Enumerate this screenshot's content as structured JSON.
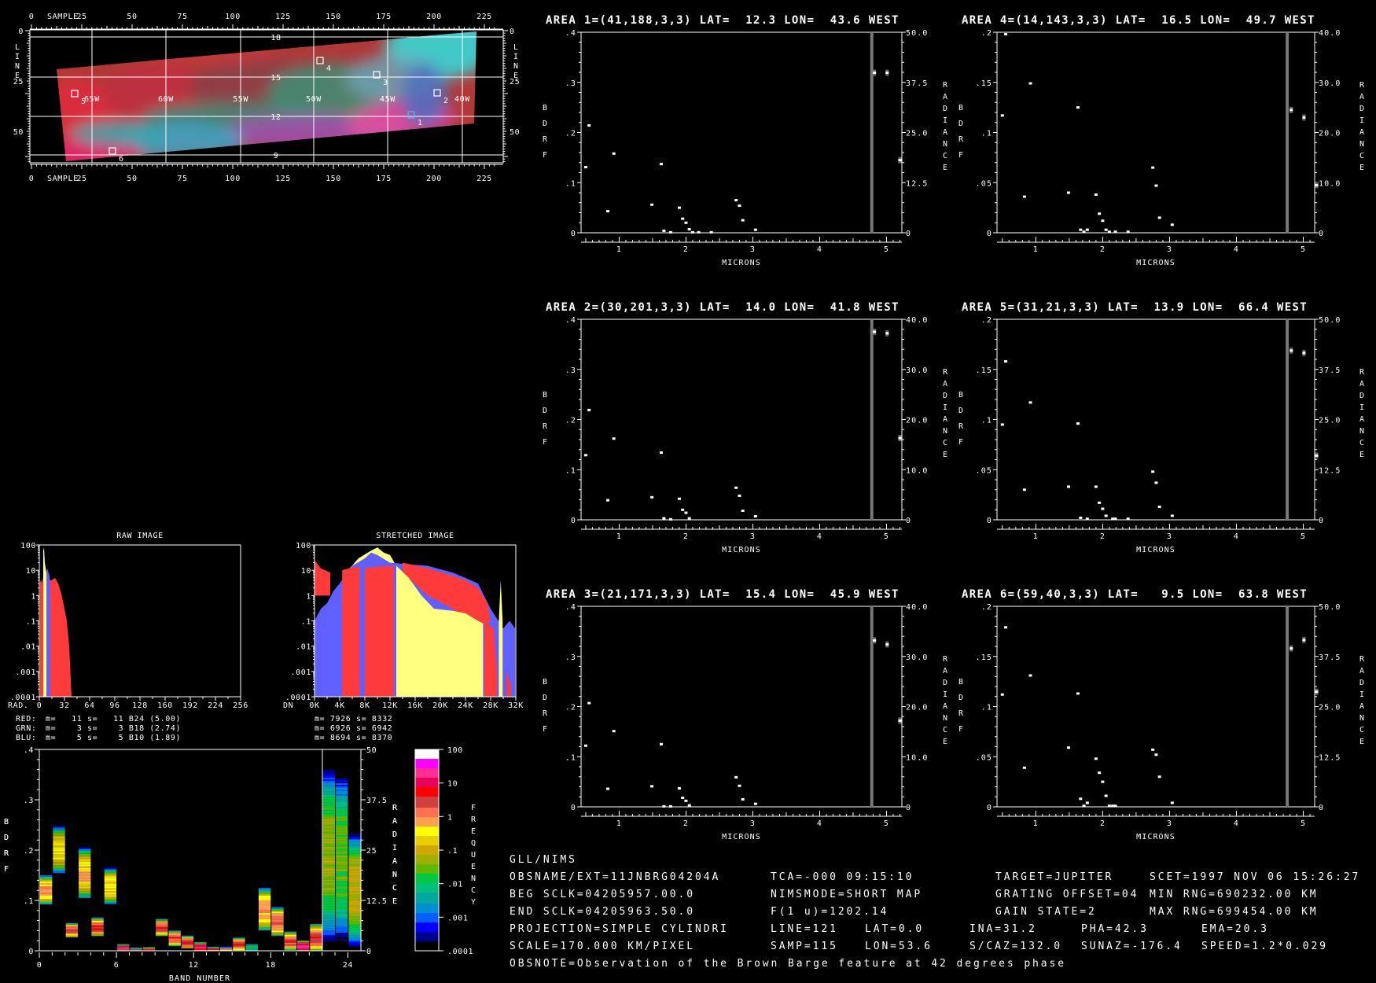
{
  "map": {
    "sample_label": "SAMPLE",
    "line_label": "LINE",
    "sample_ticks": [
      "0",
      "25",
      "50",
      "75",
      "100",
      "125",
      "150",
      "175",
      "200",
      "225"
    ],
    "line_ticks": [
      "0",
      "25",
      "50"
    ],
    "lat_labels": [
      "18",
      "15",
      "12",
      "9"
    ],
    "lon_labels": [
      "65W",
      "60W",
      "55W",
      "50W",
      "45W",
      "40W"
    ],
    "area_markers": [
      {
        "id": "1",
        "color": "#40c8f0"
      },
      {
        "id": "2",
        "color": "#ffffff"
      },
      {
        "id": "3",
        "color": "#ffffff"
      },
      {
        "id": "4",
        "color": "#ffffff"
      },
      {
        "id": "5",
        "color": "#ffffff"
      },
      {
        "id": "6",
        "color": "#ffffff"
      }
    ]
  },
  "histograms": {
    "raw": {
      "title": "RAW IMAGE",
      "x_label": "RAD.",
      "x_ticks": [
        "0",
        "32",
        "64",
        "96",
        "128",
        "160",
        "192",
        "224",
        "256"
      ],
      "y_ticks": [
        "100",
        "10",
        "1",
        ".1",
        ".01",
        ".001",
        ".0001"
      ],
      "legend": [
        {
          "channel": "RED:",
          "color": "#ff3030",
          "text": "m=   11 s=   11 B24 (5.00)"
        },
        {
          "channel": "GRN:",
          "color": "#ffff80",
          "text": "m=    3 s=    3 B18 (2.74)"
        },
        {
          "channel": "BLU:",
          "color": "#6060ff",
          "text": "m=    5 s=    5 B10 (1.89)"
        }
      ]
    },
    "stretched": {
      "title": "STRETCHED IMAGE",
      "x_label": "DN",
      "x_ticks": [
        "0K",
        "4K",
        "8K",
        "12K",
        "16K",
        "20K",
        "24K",
        "28K",
        "32K"
      ],
      "y_ticks": [
        "100",
        "10",
        "1",
        ".1",
        ".01",
        ".001",
        ".0001"
      ],
      "legend": [
        "m= 7926 s= 8332",
        "m= 6926 s= 6942",
        "m= 8694 s= 8370"
      ]
    },
    "colors": {
      "red": "#ff3a3a",
      "green": "#ffff80",
      "blue": "#6060ff"
    }
  },
  "band_plot": {
    "left_label": "BDRF",
    "right_label": "RADIANCE",
    "x_label": "BAND NUMBER",
    "x_ticks": [
      "0",
      "6",
      "12",
      "18",
      "24"
    ],
    "left_ticks": [
      "0",
      ".1",
      ".2",
      ".3",
      ".4"
    ],
    "right_ticks": [
      "0",
      "12.5",
      "25",
      "37.5",
      "50"
    ],
    "colorbar_label": "FREQUENCY",
    "colorbar_ticks": [
      "100",
      "10",
      "1",
      ".1",
      ".01",
      ".001",
      ".0001"
    ]
  },
  "chart_data": [
    {
      "type": "scatter",
      "title": "AREA 1=(41,188,3,3) LAT=  12.3 LON=  43.6 WEST",
      "xlabel": "MICRONS",
      "ylabel": "BDRF",
      "y2label": "RADIANCE",
      "xlim": [
        0.43,
        5.23
      ],
      "ylim": [
        0,
        0.4
      ],
      "y2lim": [
        0,
        50
      ],
      "xticks": [
        "1",
        "2",
        "3",
        "4",
        "5"
      ],
      "yticks": [
        "0",
        ".1",
        ".2",
        ".3",
        ".4"
      ],
      "y2ticks": [
        "0",
        "12.5",
        "25.0",
        "37.5",
        "50.0"
      ],
      "thermal_marker": 4.78,
      "bdrf": [
        [
          0.5,
          0.131
        ],
        [
          0.55,
          0.214
        ],
        [
          0.83,
          0.043
        ],
        [
          0.92,
          0.158
        ],
        [
          1.49,
          0.056
        ],
        [
          1.63,
          0.137
        ],
        [
          1.67,
          0.004
        ],
        [
          1.77,
          0.001
        ],
        [
          1.9,
          0.05
        ],
        [
          1.95,
          0.028
        ],
        [
          2.0,
          0.02
        ],
        [
          2.05,
          0.007
        ],
        [
          2.1,
          0.001
        ],
        [
          2.19,
          0.001
        ],
        [
          2.38,
          0.001
        ],
        [
          2.75,
          0.065
        ],
        [
          2.8,
          0.054
        ],
        [
          2.85,
          0.025
        ],
        [
          3.04,
          0.006
        ]
      ],
      "radiance": [
        [
          4.82,
          39.9
        ],
        [
          5.01,
          39.9
        ],
        [
          5.2,
          18.1
        ]
      ]
    },
    {
      "type": "scatter",
      "title": "AREA 2=(30,201,3,3) LAT=  14.0 LON=  41.8 WEST",
      "xlabel": "MICRONS",
      "ylabel": "BDRF",
      "y2label": "RADIANCE",
      "xlim": [
        0.43,
        5.23
      ],
      "ylim": [
        0,
        0.4
      ],
      "y2lim": [
        0,
        40
      ],
      "xticks": [
        "1",
        "2",
        "3",
        "4",
        "5"
      ],
      "yticks": [
        "0",
        ".1",
        ".2",
        ".3",
        ".4"
      ],
      "y2ticks": [
        "0",
        "10.0",
        "20.0",
        "30.0",
        "40.0"
      ],
      "thermal_marker": 4.78,
      "bdrf": [
        [
          0.5,
          0.129
        ],
        [
          0.55,
          0.219
        ],
        [
          0.83,
          0.039
        ],
        [
          0.92,
          0.162
        ],
        [
          1.49,
          0.045
        ],
        [
          1.63,
          0.134
        ],
        [
          1.67,
          0.003
        ],
        [
          1.77,
          0.001
        ],
        [
          1.9,
          0.042
        ],
        [
          1.95,
          0.02
        ],
        [
          2.0,
          0.014
        ],
        [
          2.05,
          0.003
        ],
        [
          2.75,
          0.064
        ],
        [
          2.8,
          0.048
        ],
        [
          2.85,
          0.018
        ],
        [
          3.04,
          0.007
        ]
      ],
      "radiance": [
        [
          4.82,
          37.5
        ],
        [
          5.01,
          37.2
        ],
        [
          5.2,
          16.3
        ]
      ]
    },
    {
      "type": "scatter",
      "title": "AREA 3=(21,171,3,3) LAT=  15.4 LON=  45.9 WEST",
      "xlabel": "MICRONS",
      "ylabel": "BDRF",
      "y2label": "RADIANCE",
      "xlim": [
        0.43,
        5.23
      ],
      "ylim": [
        0,
        0.4
      ],
      "y2lim": [
        0,
        40
      ],
      "xticks": [
        "1",
        "2",
        "3",
        "4",
        "5"
      ],
      "yticks": [
        "0",
        ".1",
        ".2",
        ".3",
        ".4"
      ],
      "y2ticks": [
        "0",
        "10.0",
        "20.0",
        "30.0",
        "40.0"
      ],
      "thermal_marker": 4.78,
      "bdrf": [
        [
          0.5,
          0.122
        ],
        [
          0.55,
          0.207
        ],
        [
          0.83,
          0.036
        ],
        [
          0.92,
          0.151
        ],
        [
          1.49,
          0.041
        ],
        [
          1.63,
          0.125
        ],
        [
          1.67,
          0.001
        ],
        [
          1.77,
          0.001
        ],
        [
          1.9,
          0.037
        ],
        [
          1.95,
          0.018
        ],
        [
          2.0,
          0.012
        ],
        [
          2.05,
          0.003
        ],
        [
          2.75,
          0.059
        ],
        [
          2.8,
          0.042
        ],
        [
          2.85,
          0.015
        ],
        [
          3.04,
          0.006
        ]
      ],
      "radiance": [
        [
          4.82,
          33.2
        ],
        [
          5.01,
          32.4
        ],
        [
          5.2,
          17.2
        ]
      ]
    },
    {
      "type": "scatter",
      "title": "AREA 4=(14,143,3,3) LAT=  16.5 LON=  49.7 WEST",
      "xlabel": "MICRONS",
      "ylabel": "BDRF",
      "y2label": "RADIANCE",
      "xlim": [
        0.42,
        5.17
      ],
      "ylim": [
        0,
        0.2
      ],
      "y2lim": [
        0,
        40
      ],
      "xticks": [
        "1",
        "2",
        "3",
        "4",
        "5"
      ],
      "yticks": [
        "0",
        ".05",
        ".1",
        ".15",
        ".2"
      ],
      "y2ticks": [
        "0",
        "10.0",
        "20.0",
        "30.0",
        "40.0"
      ],
      "thermal_marker": 4.76,
      "bdrf": [
        [
          0.5,
          0.117
        ],
        [
          0.55,
          0.198
        ],
        [
          0.83,
          0.036
        ],
        [
          0.92,
          0.149
        ],
        [
          1.49,
          0.04
        ],
        [
          1.63,
          0.125
        ],
        [
          1.67,
          0.003
        ],
        [
          1.72,
          0.001
        ],
        [
          1.77,
          0.003
        ],
        [
          1.9,
          0.038
        ],
        [
          1.95,
          0.019
        ],
        [
          2.0,
          0.012
        ],
        [
          2.05,
          0.003
        ],
        [
          2.1,
          0.001
        ],
        [
          2.19,
          0.001
        ],
        [
          2.38,
          0.001
        ],
        [
          2.75,
          0.065
        ],
        [
          2.8,
          0.047
        ],
        [
          2.85,
          0.015
        ],
        [
          3.04,
          0.008
        ]
      ],
      "radiance": [
        [
          4.82,
          24.5
        ],
        [
          5.01,
          23.0
        ],
        [
          5.2,
          9.5
        ]
      ]
    },
    {
      "type": "scatter",
      "title": "AREA 5=(31,21,3,3) LAT=  13.9 LON=  66.4 WEST",
      "xlabel": "MICRONS",
      "ylabel": "BDRF",
      "y2label": "RADIANCE",
      "xlim": [
        0.42,
        5.17
      ],
      "ylim": [
        0,
        0.2
      ],
      "y2lim": [
        0,
        50
      ],
      "xticks": [
        "1",
        "2",
        "3",
        "4",
        "5"
      ],
      "yticks": [
        "0",
        ".05",
        ".1",
        ".15",
        ".2"
      ],
      "y2ticks": [
        "0",
        "12.5",
        "25.0",
        "37.5",
        "50.0"
      ],
      "thermal_marker": 4.76,
      "bdrf": [
        [
          0.5,
          0.095
        ],
        [
          0.55,
          0.158
        ],
        [
          0.83,
          0.03
        ],
        [
          0.92,
          0.117
        ],
        [
          1.49,
          0.033
        ],
        [
          1.63,
          0.096
        ],
        [
          1.67,
          0.002
        ],
        [
          1.77,
          0.001
        ],
        [
          1.9,
          0.033
        ],
        [
          1.95,
          0.017
        ],
        [
          2.0,
          0.011
        ],
        [
          2.05,
          0.004
        ],
        [
          2.15,
          0.001
        ],
        [
          2.19,
          0.001
        ],
        [
          2.38,
          0.001
        ],
        [
          2.75,
          0.048
        ],
        [
          2.8,
          0.037
        ],
        [
          2.85,
          0.013
        ],
        [
          3.04,
          0.004
        ]
      ],
      "radiance": [
        [
          4.82,
          42.2
        ],
        [
          5.01,
          41.6
        ],
        [
          5.2,
          16.0
        ]
      ]
    },
    {
      "type": "scatter",
      "title": "AREA 6=(59,40,3,3) LAT=   9.5 LON=  63.8 WEST",
      "xlabel": "MICRONS",
      "ylabel": "BDRF",
      "y2label": "RADIANCE",
      "xlim": [
        0.42,
        5.17
      ],
      "ylim": [
        0,
        0.2
      ],
      "y2lim": [
        0,
        50
      ],
      "xticks": [
        "1",
        "2",
        "3",
        "4",
        "5"
      ],
      "yticks": [
        "0",
        ".05",
        ".1",
        ".15",
        ".2"
      ],
      "y2ticks": [
        "0",
        "12.5",
        "25.0",
        "37.5",
        "50.0"
      ],
      "thermal_marker": 4.76,
      "bdrf": [
        [
          0.5,
          0.112
        ],
        [
          0.55,
          0.179
        ],
        [
          0.83,
          0.039
        ],
        [
          0.92,
          0.131
        ],
        [
          1.49,
          0.059
        ],
        [
          1.63,
          0.113
        ],
        [
          1.67,
          0.008
        ],
        [
          1.72,
          0.001
        ],
        [
          1.77,
          0.004
        ],
        [
          1.9,
          0.048
        ],
        [
          1.95,
          0.034
        ],
        [
          2.0,
          0.025
        ],
        [
          2.05,
          0.011
        ],
        [
          2.1,
          0.001
        ],
        [
          2.15,
          0.001
        ],
        [
          2.19,
          0.001
        ],
        [
          2.75,
          0.057
        ],
        [
          2.8,
          0.052
        ],
        [
          2.85,
          0.03
        ],
        [
          3.04,
          0.004
        ]
      ],
      "radiance": [
        [
          4.82,
          39.5
        ],
        [
          5.01,
          41.6
        ],
        [
          5.2,
          28.7
        ]
      ]
    },
    {
      "type": "heatmap",
      "title": "",
      "xlabel": "BAND NUMBER",
      "ylabel": "BDRF",
      "y2label": "RADIANCE",
      "xlim": [
        0,
        25
      ],
      "ylim": [
        0,
        0.4
      ],
      "y2lim": [
        0,
        50
      ],
      "colorbar": {
        "label": "FREQUENCY",
        "range": [
          0.0001,
          100
        ],
        "scale": "log"
      },
      "bands": [
        {
          "band": 0,
          "axis": "bdrf",
          "range": [
            0.093,
            0.15
          ],
          "peak_freq": 1
        },
        {
          "band": 1,
          "axis": "bdrf",
          "range": [
            0.155,
            0.248
          ],
          "peak_freq": 0.3
        },
        {
          "band": 2,
          "axis": "bdrf",
          "range": [
            0.027,
            0.055
          ],
          "peak_freq": 3
        },
        {
          "band": 3,
          "axis": "bdrf",
          "range": [
            0.105,
            0.205
          ],
          "peak_freq": 0.6
        },
        {
          "band": 4,
          "axis": "bdrf",
          "range": [
            0.03,
            0.066
          ],
          "peak_freq": 3
        },
        {
          "band": 5,
          "axis": "bdrf",
          "range": [
            0.093,
            0.165
          ],
          "peak_freq": 0.5
        },
        {
          "band": 6,
          "axis": "bdrf",
          "range": [
            0.001,
            0.013
          ],
          "peak_freq": 20
        },
        {
          "band": 7,
          "axis": "bdrf",
          "range": [
            0.001,
            0.006
          ],
          "peak_freq": 5
        },
        {
          "band": 8,
          "axis": "bdrf",
          "range": [
            0.001,
            0.007
          ],
          "peak_freq": 20
        },
        {
          "band": 9,
          "axis": "bdrf",
          "range": [
            0.03,
            0.063
          ],
          "peak_freq": 3
        },
        {
          "band": 10,
          "axis": "bdrf",
          "range": [
            0.01,
            0.04
          ],
          "peak_freq": 3
        },
        {
          "band": 11,
          "axis": "bdrf",
          "range": [
            0.005,
            0.03
          ],
          "peak_freq": 3
        },
        {
          "band": 12,
          "axis": "bdrf",
          "range": [
            0.0,
            0.017
          ],
          "peak_freq": 10
        },
        {
          "band": 13,
          "axis": "bdrf",
          "range": [
            0.0,
            0.008
          ],
          "peak_freq": 3
        },
        {
          "band": 14,
          "axis": "bdrf",
          "range": [
            0.0,
            0.008
          ],
          "peak_freq": 1
        },
        {
          "band": 15,
          "axis": "bdrf",
          "range": [
            0.0,
            0.026
          ],
          "peak_freq": 3
        },
        {
          "band": 16,
          "axis": "bdrf",
          "range": [
            0.0,
            0.016
          ],
          "peak_freq": 0.01
        },
        {
          "band": 17,
          "axis": "bdrf",
          "range": [
            0.041,
            0.125
          ],
          "peak_freq": 1
        },
        {
          "band": 18,
          "axis": "bdrf",
          "range": [
            0.03,
            0.087
          ],
          "peak_freq": 2
        },
        {
          "band": 19,
          "axis": "bdrf",
          "range": [
            0.002,
            0.038
          ],
          "peak_freq": 3
        },
        {
          "band": 20,
          "axis": "bdrf",
          "range": [
            0.0,
            0.02
          ],
          "peak_freq": 20
        },
        {
          "band": 21,
          "axis": "bdrf",
          "range": [
            0.0,
            0.053
          ],
          "peak_freq": 3
        },
        {
          "band": 22,
          "axis": "radiance",
          "range": [
            1,
            46.5
          ],
          "peak_freq": 0.05
        },
        {
          "band": 23,
          "axis": "radiance",
          "range": [
            1,
            45.5
          ],
          "peak_freq": 0.03
        },
        {
          "band": 24,
          "axis": "radiance",
          "range": [
            1,
            29.6
          ],
          "peak_freq": 0.1
        }
      ]
    }
  ],
  "info": {
    "instrument": "GLL/NIMS",
    "obsname": "OBSNAME/EXT=11JNBRG04204A",
    "tca": "TCA=-000 09:15:10",
    "target": "TARGET=JUPITER",
    "scet": "SCET=1997 NOV 06 15:26:27",
    "beg_sclk": "BEG SCLK=04205957.00.0",
    "nimsmode": "NIMSMODE=SHORT MAP",
    "grating_offset": "GRATING OFFSET=04",
    "min_rng": "MIN RNG=690232.00 KM",
    "end_sclk": "END SCLK=04205963.50.0",
    "f1u": "F(1 u)=1202.14",
    "gain_state": "GAIN STATE=2",
    "max_rng": "MAX RNG=699454.00 KM",
    "projection": "PROJECTION=SIMPLE CYLINDRI",
    "line": "LINE=121",
    "lat": "LAT=0.0",
    "ina": "INA=31.2",
    "pha": "PHA=42.3",
    "ema": "EMA=20.3",
    "scale": "SCALE=170.000 KM/PIXEL",
    "samp": "SAMP=115",
    "lon": "LON=53.6",
    "scaz": "S/CAZ=132.0",
    "sunaz": "SUNAZ=-176.4",
    "speed": "SPEED=1.2*0.029",
    "obsnote": "OBSNOTE=Observation of the Brown Barge feature at 42 degrees phase"
  }
}
